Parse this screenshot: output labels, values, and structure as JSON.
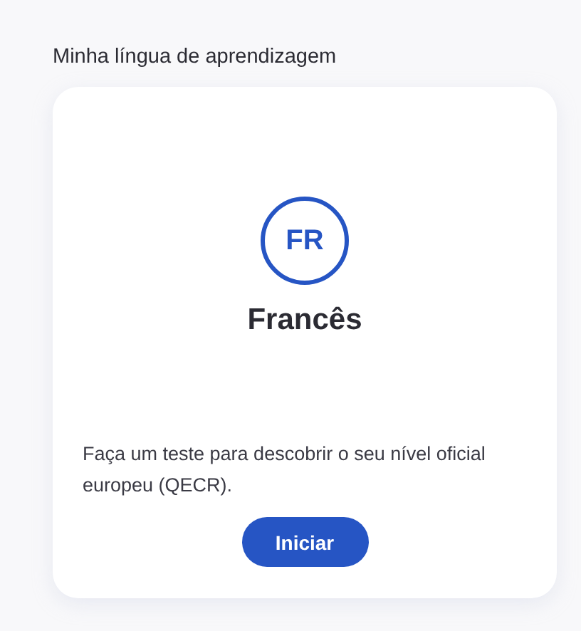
{
  "section_title": "Minha língua de aprendizagem",
  "language": {
    "code": "FR",
    "name": "Francês"
  },
  "description": "Faça um teste para descobrir o seu nível oficial europeu (QECR).",
  "button": "Iniciar"
}
